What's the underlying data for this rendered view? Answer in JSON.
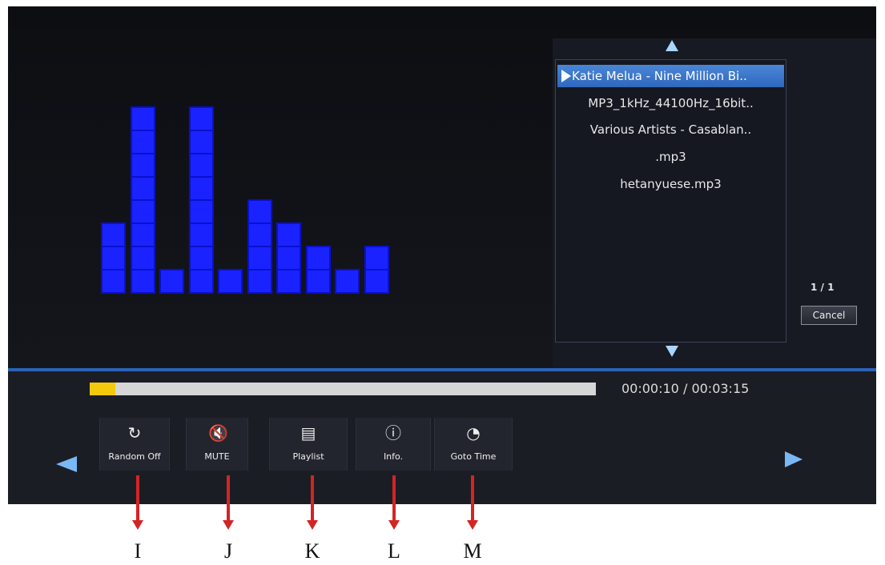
{
  "playlist": {
    "items": [
      "Katie Melua - Nine Million Bi..",
      "MP3_1kHz_44100Hz_16bit..",
      "Various Artists - Casablan..",
      ".mp3",
      "hetanyuese.mp3"
    ],
    "selected_index": 0,
    "page_indicator": "1 / 1",
    "cancel_label": "Cancel"
  },
  "equalizer": {
    "bar_levels": [
      3,
      8,
      1,
      8,
      1,
      4,
      3,
      2,
      1,
      2
    ]
  },
  "playback": {
    "elapsed_time": "00:00:10",
    "separator": "/",
    "total_time": "00:03:15",
    "progress_fraction": 0.05
  },
  "controls": [
    {
      "label": "Random Off",
      "icon": "shuffle-icon",
      "glyph": "↻"
    },
    {
      "label": "MUTE",
      "icon": "mute-icon",
      "glyph": "🔇"
    },
    {
      "label": "Playlist",
      "icon": "playlist-icon",
      "glyph": "▤"
    },
    {
      "label": "Info.",
      "icon": "info-icon",
      "glyph": "ⓘ"
    },
    {
      "label": "Goto Time",
      "icon": "clock-icon",
      "glyph": "◔"
    }
  ],
  "callouts": [
    "I",
    "J",
    "K",
    "L",
    "M"
  ],
  "colors": {
    "equalizer": "#1a23ff",
    "selection": "#3a76c9",
    "progress": "#f2c90c",
    "accent_arrow": "#7ab8f5",
    "callout": "#d42424"
  }
}
